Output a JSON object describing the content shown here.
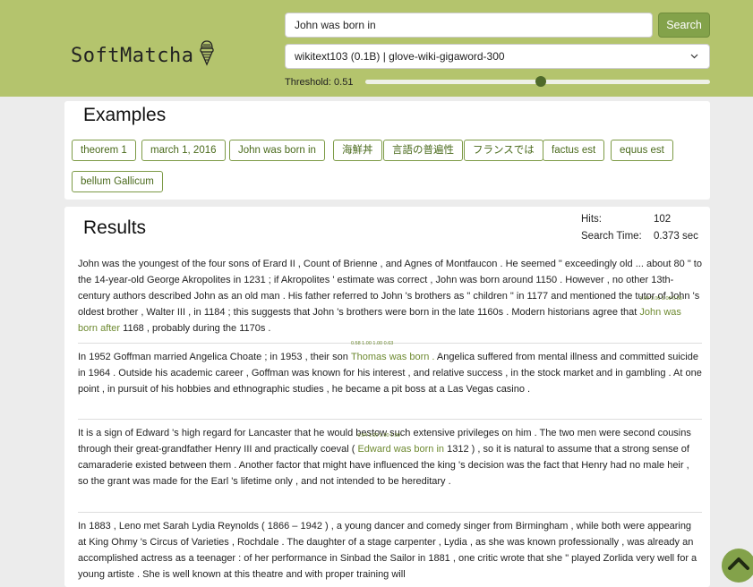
{
  "brand": {
    "name": "SoftMatcha",
    "icon": "ice-cream-icon"
  },
  "search": {
    "query": "John was born in",
    "button_label": "Search"
  },
  "model_select": {
    "selected": "wikitext103 (0.1B) | glove-wiki-gigaword-300"
  },
  "threshold": {
    "label": "Threshold: 0.51",
    "value": 0.51
  },
  "examples": {
    "title": "Examples",
    "items": [
      "theorem 1",
      "march 1, 2016",
      "John was born in",
      "海鮮丼",
      "言語の普遍性",
      "フランスでは",
      "factus est",
      "equus est",
      "bellum Gallicum"
    ]
  },
  "results": {
    "title": "Results",
    "hits_label": "Hits:",
    "hits_value": "102",
    "time_label": "Search Time:",
    "time_value": "0.373 sec",
    "items": [
      {
        "before": "John was the youngest of the four sons of Erard II , Count of Brienne , and Agnes of Montfaucon . He seemed \" exceedingly old ... about 80 \" to the 14-year-old George Akropolites in 1231 ; if Akropolites ' estimate was correct , John was born around 1150 . However , no other 13th-century authors described John as an old man . His father referred to John 's brothers as \" children \" in 1177 and mentioned the tutor of John 's oldest brother , Walter III , in 1184 ; this suggests that John 's brothers were born in the late 1160s . Modern historians agree that ",
        "match": "John was born after",
        "scores": "1.00   1.00   1.00   0.58",
        "after": " 1168 , probably during the 1170s ."
      },
      {
        "before": "In 1952 Goffman married Angelica Choate ; in 1953 , their son ",
        "match": "Thomas was born  .",
        "scores": "0.58   1.00   1.00   0.63",
        "after": " Angelica suffered from mental illness and committed suicide in 1964 . Outside his academic career , Goffman was known for his interest , and relative success , in the stock market and in gambling . At one point , in pursuit of his hobbies and ethnographic studies , he became a pit boss at a Las Vegas casino ."
      },
      {
        "before": "It is a sign of Edward 's high regard for Lancaster that he would bestow such extensive privileges on him . The two men were second cousins through their great-grandfather Henry III and practically coeval ( ",
        "match": "Edward was born in",
        "scores": "0.54   1.00   1.00   1.00",
        "after": " 1312 ) , so it is natural to assume that a strong sense of camaraderie existed between them . Another factor that might have influenced the king 's decision was the fact that Henry had no male heir , so the grant was made for the Earl 's lifetime only , and not intended to be hereditary ."
      },
      {
        "before": "In 1883 , Leno met Sarah Lydia Reynolds ( 1866 – 1942 ) , a young dancer and comedy singer from Birmingham , while both were appearing at King Ohmy 's Circus of Varieties , Rochdale . The daughter of a stage carpenter , Lydia , as she was known professionally , was already an accomplished actress as a teenager : of her performance in Sinbad the Sailor in 1881 , one critic wrote that she \" played Zorlida very well for a young artiste . She is well known at this theatre and with proper training will",
        "match": "",
        "scores": "",
        "after": ""
      }
    ]
  },
  "scroll_top": {
    "icon": "chevron-up-icon"
  },
  "colors": {
    "header": "#b4c46d",
    "accent": "#83a24a",
    "match_text": "#6e8a31"
  }
}
